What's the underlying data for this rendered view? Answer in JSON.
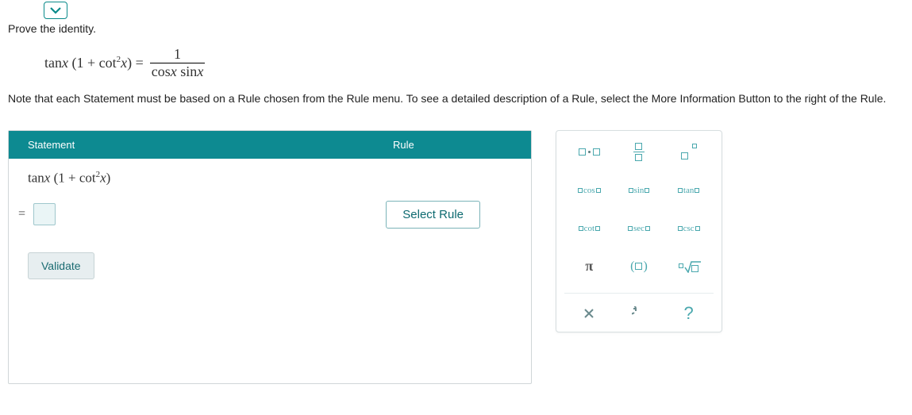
{
  "prompt": {
    "title": "Prove the identity.",
    "lhs": "tan x (1 + cot²x) =",
    "frac_num": "1",
    "frac_den": "cos x sin x",
    "note": "Note that each Statement must be based on a Rule chosen from the Rule menu. To see a detailed description of a Rule, select the More Information Button to the right of the Rule."
  },
  "panel": {
    "header_statement": "Statement",
    "header_rule": "Rule",
    "given_expr": "tan x (1 + cot²x)",
    "eq_sign": "=",
    "select_rule_label": "Select Rule",
    "validate_label": "Validate"
  },
  "palette": {
    "trig": {
      "cos": "cos",
      "sin": "sin",
      "tan": "tan",
      "cot": "cot",
      "sec": "sec",
      "csc": "csc"
    },
    "pi": "π"
  }
}
